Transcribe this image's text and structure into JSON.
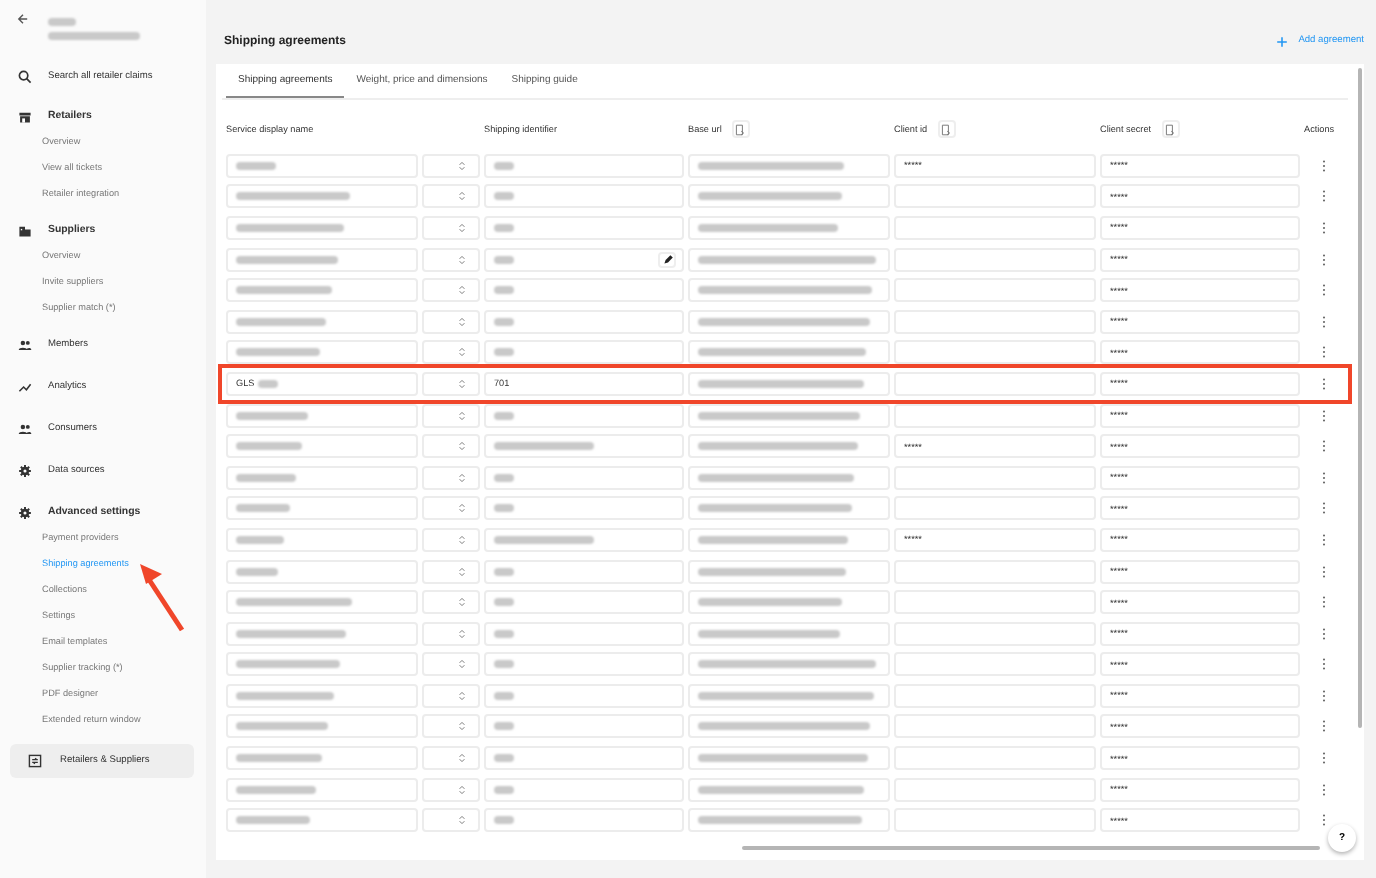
{
  "sidebar": {
    "search": "Search all retailer claims",
    "groups": [
      {
        "label": "Retailers",
        "children": [
          {
            "label": "Overview",
            "selected": false
          },
          {
            "label": "View all tickets",
            "selected": false
          },
          {
            "label": "Retailer integration",
            "selected": false
          }
        ]
      },
      {
        "label": "Suppliers",
        "children": [
          {
            "label": "Overview",
            "selected": false
          },
          {
            "label": "Invite suppliers",
            "selected": false
          },
          {
            "label": "Supplier match (*)",
            "selected": false
          }
        ]
      },
      {
        "label": "Members"
      },
      {
        "label": "Analytics"
      },
      {
        "label": "Consumers"
      },
      {
        "label": "Data sources"
      },
      {
        "label": "Advanced settings",
        "children": [
          {
            "label": "Payment providers",
            "selected": false
          },
          {
            "label": "Shipping agreements",
            "selected": true
          },
          {
            "label": "Collections",
            "selected": false
          },
          {
            "label": "Settings",
            "selected": false
          },
          {
            "label": "Email templates",
            "selected": false
          },
          {
            "label": "Supplier tracking (*)",
            "selected": false
          },
          {
            "label": "PDF designer",
            "selected": false
          },
          {
            "label": "Extended return window",
            "selected": false
          }
        ]
      }
    ],
    "bottom_button": "Retailers & Suppliers"
  },
  "page": {
    "title": "Shipping agreements",
    "add_button": "Add agreement"
  },
  "tabs": [
    {
      "label": "Shipping agreements",
      "selected": true
    },
    {
      "label": "Weight, price and dimensions",
      "selected": false
    },
    {
      "label": "Shipping guide",
      "selected": false
    }
  ],
  "columns": [
    {
      "label": "Service display name",
      "kind": "plain"
    },
    {
      "label": "Shipping identifier",
      "kind": "plain"
    },
    {
      "label": "Base url",
      "kind": "filter"
    },
    {
      "label": "Client id",
      "kind": "filter"
    },
    {
      "label": "Client secret",
      "kind": "filter"
    },
    {
      "label": "Actions",
      "kind": "plain"
    }
  ],
  "rows": [
    {
      "client_id": "*****",
      "client_secret": "*****",
      "highlighted": false,
      "editing": false
    },
    {
      "client_secret": "*****",
      "highlighted": false,
      "editing": false
    },
    {
      "client_secret": "*****",
      "highlighted": false,
      "editing": false
    },
    {
      "client_secret": "*****",
      "highlighted": false,
      "editing": true
    },
    {
      "client_secret": "*****",
      "highlighted": false,
      "editing": false
    },
    {
      "client_secret": "*****",
      "highlighted": false,
      "editing": false
    },
    {
      "client_secret": "*****",
      "highlighted": false,
      "editing": false
    },
    {
      "service": "GLS",
      "identifier": "701",
      "client_secret": "*****",
      "highlighted": true,
      "editing": false
    },
    {
      "client_secret": "*****",
      "highlighted": false,
      "editing": false
    },
    {
      "client_id": "*****",
      "client_secret": "*****",
      "highlighted": false,
      "editing": false
    },
    {
      "client_secret": "*****",
      "highlighted": false,
      "editing": false
    },
    {
      "client_secret": "*****",
      "highlighted": false,
      "editing": false
    },
    {
      "client_id": "*****",
      "client_secret": "*****",
      "highlighted": false,
      "editing": false
    },
    {
      "client_secret": "*****",
      "highlighted": false,
      "editing": false
    },
    {
      "client_secret": "*****",
      "highlighted": false,
      "editing": false
    },
    {
      "client_secret": "*****",
      "highlighted": false,
      "editing": false
    },
    {
      "client_secret": "*****",
      "highlighted": false,
      "editing": false
    },
    {
      "client_secret": "*****",
      "highlighted": false,
      "editing": false
    },
    {
      "client_secret": "*****",
      "highlighted": false,
      "editing": false
    },
    {
      "client_secret": "*****",
      "highlighted": false,
      "editing": false
    },
    {
      "client_secret": "*****",
      "highlighted": false,
      "editing": false
    },
    {
      "client_secret": "*****",
      "highlighted": false,
      "editing": false
    }
  ],
  "help_button": "?"
}
